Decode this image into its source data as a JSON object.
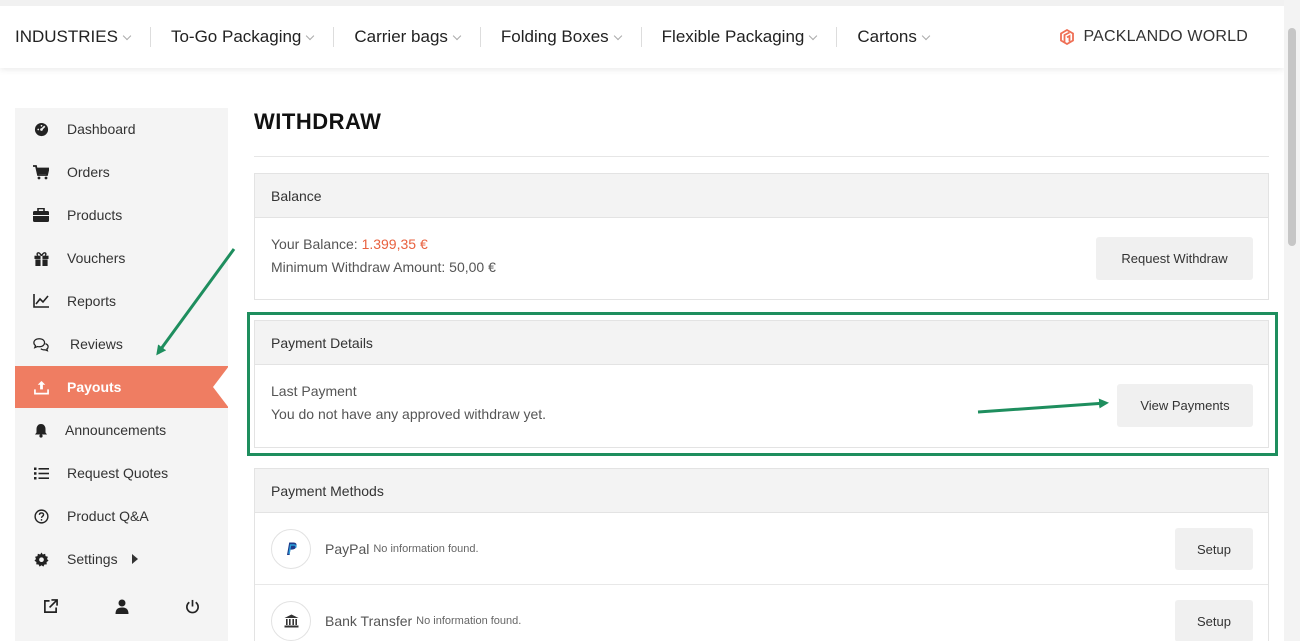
{
  "nav": {
    "items": [
      "INDUSTRIES",
      "To-Go Packaging",
      "Carrier bags",
      "Folding Boxes",
      "Flexible Packaging",
      "Cartons"
    ],
    "brand": "PACKLANDO WORLD"
  },
  "sidebar": {
    "items": [
      {
        "label": "Dashboard",
        "icon": "dashboard-icon"
      },
      {
        "label": "Orders",
        "icon": "cart-icon"
      },
      {
        "label": "Products",
        "icon": "briefcase-icon"
      },
      {
        "label": "Vouchers",
        "icon": "gift-icon"
      },
      {
        "label": "Reports",
        "icon": "line-chart-icon"
      },
      {
        "label": "Reviews",
        "icon": "comments-icon"
      },
      {
        "label": "Payouts",
        "icon": "upload-icon",
        "active": true
      },
      {
        "label": "Announcements",
        "icon": "bell-icon"
      },
      {
        "label": "Request Quotes",
        "icon": "list-icon"
      },
      {
        "label": "Product Q&A",
        "icon": "question-circle-icon"
      },
      {
        "label": "Settings",
        "icon": "gear-icon"
      }
    ],
    "bottom_icons": [
      "external-link-icon",
      "user-icon",
      "power-icon"
    ]
  },
  "page": {
    "title": "WITHDRAW"
  },
  "balance": {
    "heading": "Balance",
    "your_balance_label": "Your Balance:",
    "your_balance_value": "1.399,35 €",
    "minimum_label": "Minimum Withdraw Amount:",
    "minimum_value": "50,00 €",
    "button": "Request Withdraw"
  },
  "payment_details": {
    "heading": "Payment Details",
    "last_payment_label": "Last Payment",
    "message": "You do not have any approved withdraw yet.",
    "button": "View Payments"
  },
  "payment_methods": {
    "heading": "Payment Methods",
    "methods": [
      {
        "name": "PayPal",
        "note": "No information found.",
        "button": "Setup",
        "icon": "paypal-icon"
      },
      {
        "name": "Bank Transfer",
        "note": "No information found.",
        "button": "Setup",
        "icon": "bank-icon"
      }
    ]
  },
  "colors": {
    "accent": "#ef7d62",
    "balance_value": "#e8613f",
    "annotation": "#1e8e5e"
  }
}
